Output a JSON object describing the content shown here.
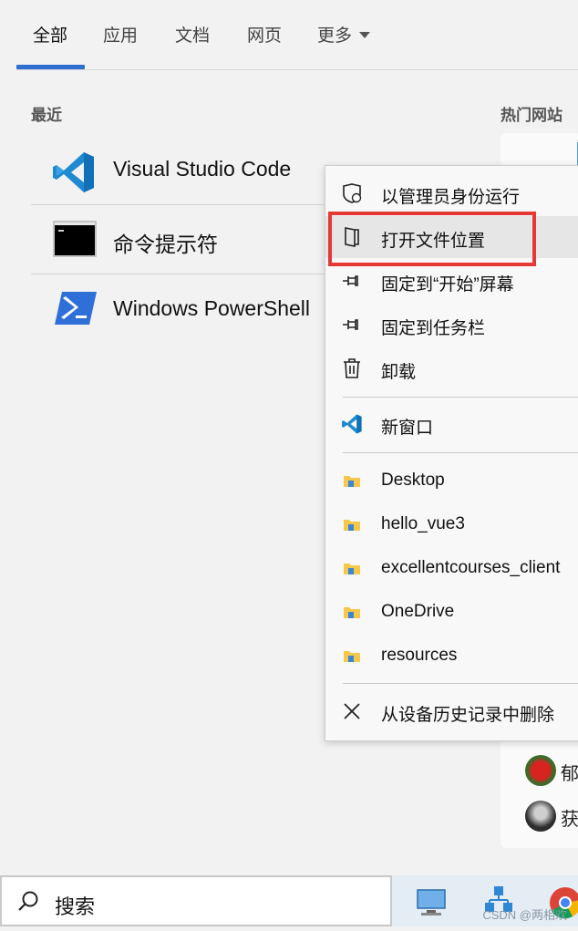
{
  "tabs": [
    {
      "label": "全部"
    },
    {
      "label": "应用"
    },
    {
      "label": "文档"
    },
    {
      "label": "网页"
    },
    {
      "label": "更多"
    }
  ],
  "recent": {
    "heading": "最近",
    "items": [
      {
        "label": "Visual Studio Code",
        "icon": "vscode-icon"
      },
      {
        "label": "命令提示符",
        "icon": "cmd-icon"
      },
      {
        "label": "Windows PowerShell",
        "icon": "powershell-icon"
      }
    ]
  },
  "hot_sites": {
    "heading": "热门网站"
  },
  "context_menu": {
    "items": [
      {
        "label": "以管理员身份运行",
        "icon": "shield-icon"
      },
      {
        "label": "打开文件位置",
        "icon": "open-file-location-icon"
      },
      {
        "label": "固定到“开始”屏幕",
        "icon": "pin-icon"
      },
      {
        "label": "固定到任务栏",
        "icon": "pin-icon"
      },
      {
        "label": "卸载",
        "icon": "trash-icon"
      },
      {
        "label": "新窗口",
        "icon": "vscode-icon"
      },
      {
        "label": "Desktop",
        "icon": "folder-icon"
      },
      {
        "label": "hello_vue3",
        "icon": "folder-icon"
      },
      {
        "label": "excellentcourses_client",
        "icon": "folder-icon"
      },
      {
        "label": "OneDrive",
        "icon": "folder-icon"
      },
      {
        "label": "resources",
        "icon": "folder-icon"
      },
      {
        "label": "从设备历史记录中删除",
        "icon": "close-icon"
      }
    ],
    "highlight_color": "#e53935"
  },
  "side_users": [
    {
      "label": "郁"
    },
    {
      "label": "获"
    }
  ],
  "taskbar": {
    "search_label": "搜索",
    "watermark": "CSDN @两相欢"
  },
  "colors": {
    "accent": "#2f6fd1"
  }
}
